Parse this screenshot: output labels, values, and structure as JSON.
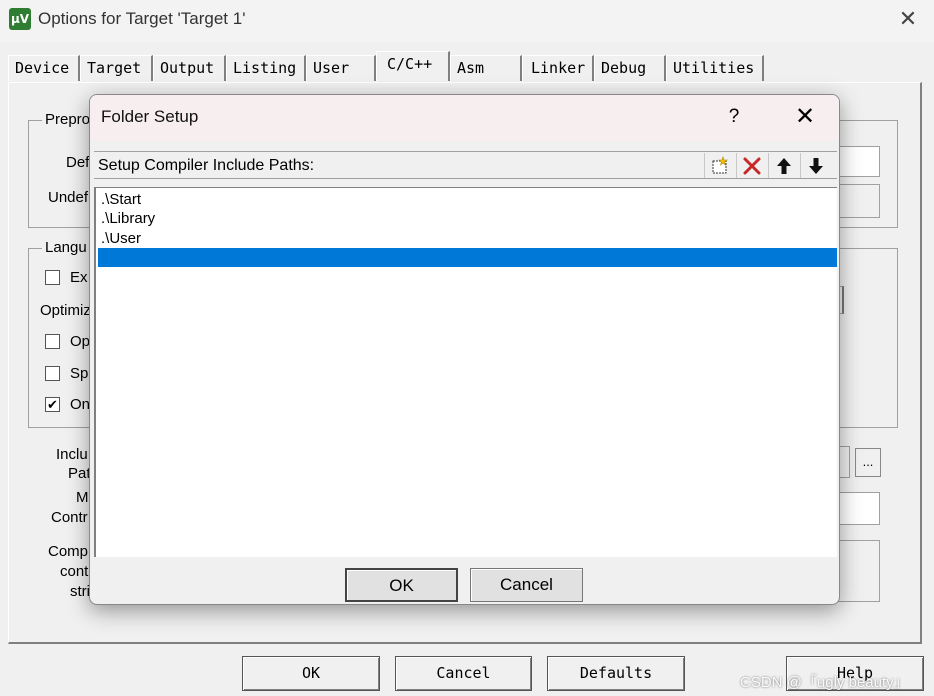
{
  "window": {
    "title": "Options for Target 'Target 1'",
    "icon_text": "µV",
    "close_glyph": "✕"
  },
  "tabs": [
    {
      "label": "Device",
      "active": false
    },
    {
      "label": "Target",
      "active": false
    },
    {
      "label": "Output",
      "active": false
    },
    {
      "label": "Listing",
      "active": false
    },
    {
      "label": "User",
      "active": false
    },
    {
      "label": "C/C++",
      "active": true
    },
    {
      "label": "Asm",
      "active": false
    },
    {
      "label": "Linker",
      "active": false
    },
    {
      "label": "Debug",
      "active": false
    },
    {
      "label": "Utilities",
      "active": false
    }
  ],
  "background": {
    "preprocessor_group": "Prepro",
    "define_label": "Def",
    "undefine_label": "Undef",
    "language_group": "Langu",
    "ex_option": "Ex",
    "optimization_label": "Optimiz",
    "op_option": "Op",
    "sp_option": "Sp",
    "on_option": "On",
    "on_checked_glyph": "✔",
    "include_label_1": "Inclu",
    "include_label_2": "Pat",
    "misc_label_1": "M",
    "misc_label_2": "Contr",
    "compiler_label_1": "Comp",
    "compiler_label_2": "cont",
    "compiler_label_3": "stri",
    "browse_button": "..."
  },
  "footer_buttons": {
    "ok": "OK",
    "cancel": "Cancel",
    "defaults": "Defaults",
    "help": "Help"
  },
  "watermark": "CSDN @「ugly beauty」",
  "dialog": {
    "title": "Folder Setup",
    "help_glyph": "?",
    "close_glyph": "✕",
    "list_header": "Setup Compiler Include Paths:",
    "paths": [
      ".\\Start",
      ".\\Library",
      ".\\User",
      ""
    ],
    "selected_index": 3,
    "ok_label": "OK",
    "cancel_label": "Cancel",
    "selection_color": "#0078d7",
    "delete_icon_color": "#c62828"
  }
}
